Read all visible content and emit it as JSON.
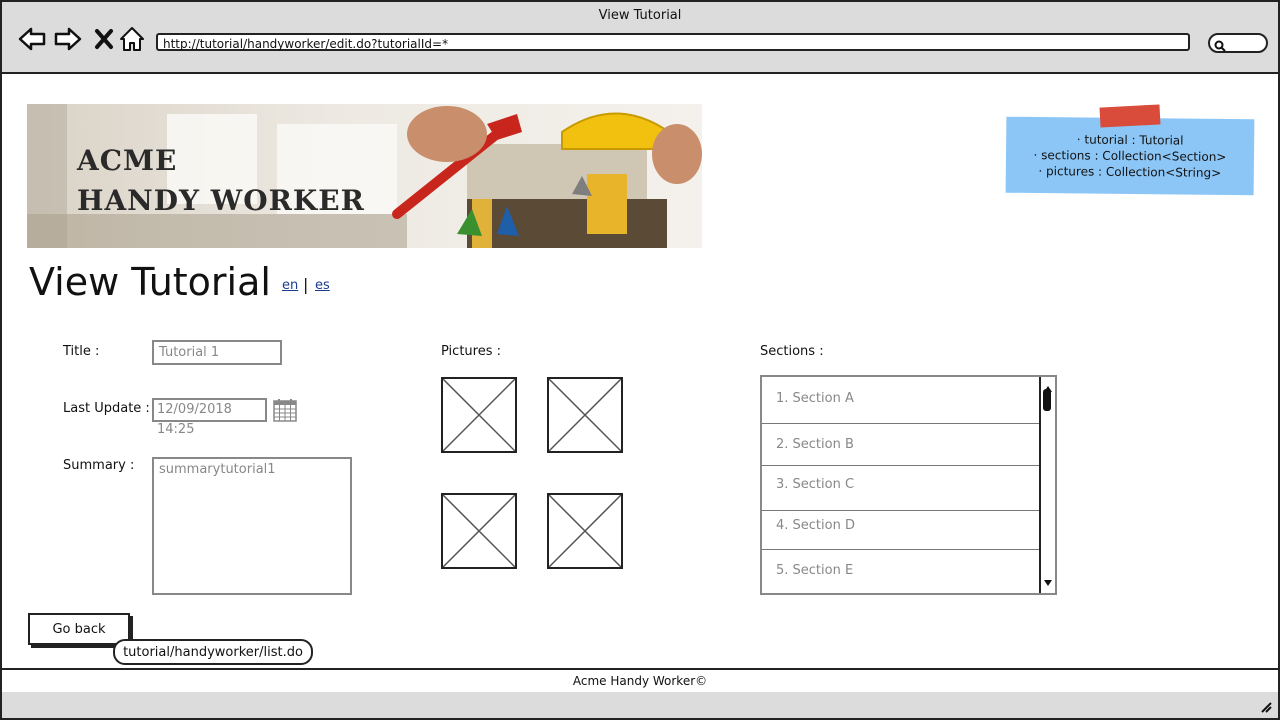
{
  "window": {
    "title": "View Tutorial"
  },
  "browser": {
    "url": "http://tutorial/handyworker/edit.do?tutorialId=*"
  },
  "banner": {
    "line1": "ACME",
    "line2": "HANDY WORKER"
  },
  "note": {
    "lines": [
      "· tutorial : Tutorial",
      "· sections : Collection<Section>",
      "· pictures : Collection<String>"
    ]
  },
  "page": {
    "title": "View Tutorial",
    "lang_en": "en",
    "lang_sep": "|",
    "lang_es": "es"
  },
  "form": {
    "title_label": "Title :",
    "title_value": "Tutorial 1",
    "last_update_label": "Last Update :",
    "last_update_value": "12/09/2018 14:25",
    "summary_label": "Summary :",
    "summary_value": "summarytutorial1"
  },
  "pictures": {
    "label": "Pictures :"
  },
  "sections": {
    "label": "Sections :",
    "items": [
      "1. Section A",
      "2. Section B",
      "3. Section C",
      "4. Section D",
      "5. Section E"
    ]
  },
  "go_back": {
    "label": "Go back",
    "tooltip": "tutorial/handyworker/list.do"
  },
  "footer": {
    "text": "Acme Handy Worker©"
  }
}
